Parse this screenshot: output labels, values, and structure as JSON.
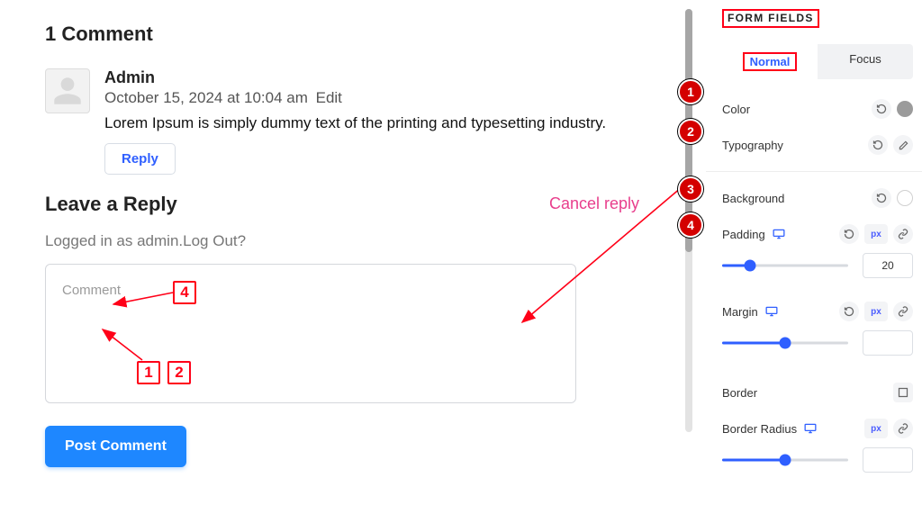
{
  "preview": {
    "comments_title": "1 Comment",
    "comment": {
      "author": "Admin",
      "date": "October 15, 2024 at 10:04 am",
      "edit": "Edit",
      "text": "Lorem Ipsum is simply dummy text of the printing and typesetting industry.",
      "reply_label": "Reply"
    },
    "reply_heading": "Leave a Reply",
    "cancel_reply": "Cancel reply",
    "logged_in_prefix": "Logged in as ",
    "logged_in_user": "admin",
    "logged_in_suffix": ".Log Out?",
    "comment_placeholder": "Comment",
    "post_button": "Post Comment"
  },
  "annotations": {
    "box_1": "1",
    "box_2": "2",
    "box_4": "4"
  },
  "panel": {
    "section_title": "FORM FIELDS",
    "tabs": {
      "normal": "Normal",
      "focus": "Focus"
    },
    "badges": {
      "n1": "1",
      "n2": "2",
      "n3": "3",
      "n4": "4"
    },
    "color_label": "Color",
    "typography_label": "Typography",
    "background_label": "Background",
    "padding_label": "Padding",
    "padding_value": "20",
    "margin_label": "Margin",
    "margin_value": "",
    "border_label": "Border",
    "border_radius_label": "Border Radius",
    "unit_px": "px"
  }
}
